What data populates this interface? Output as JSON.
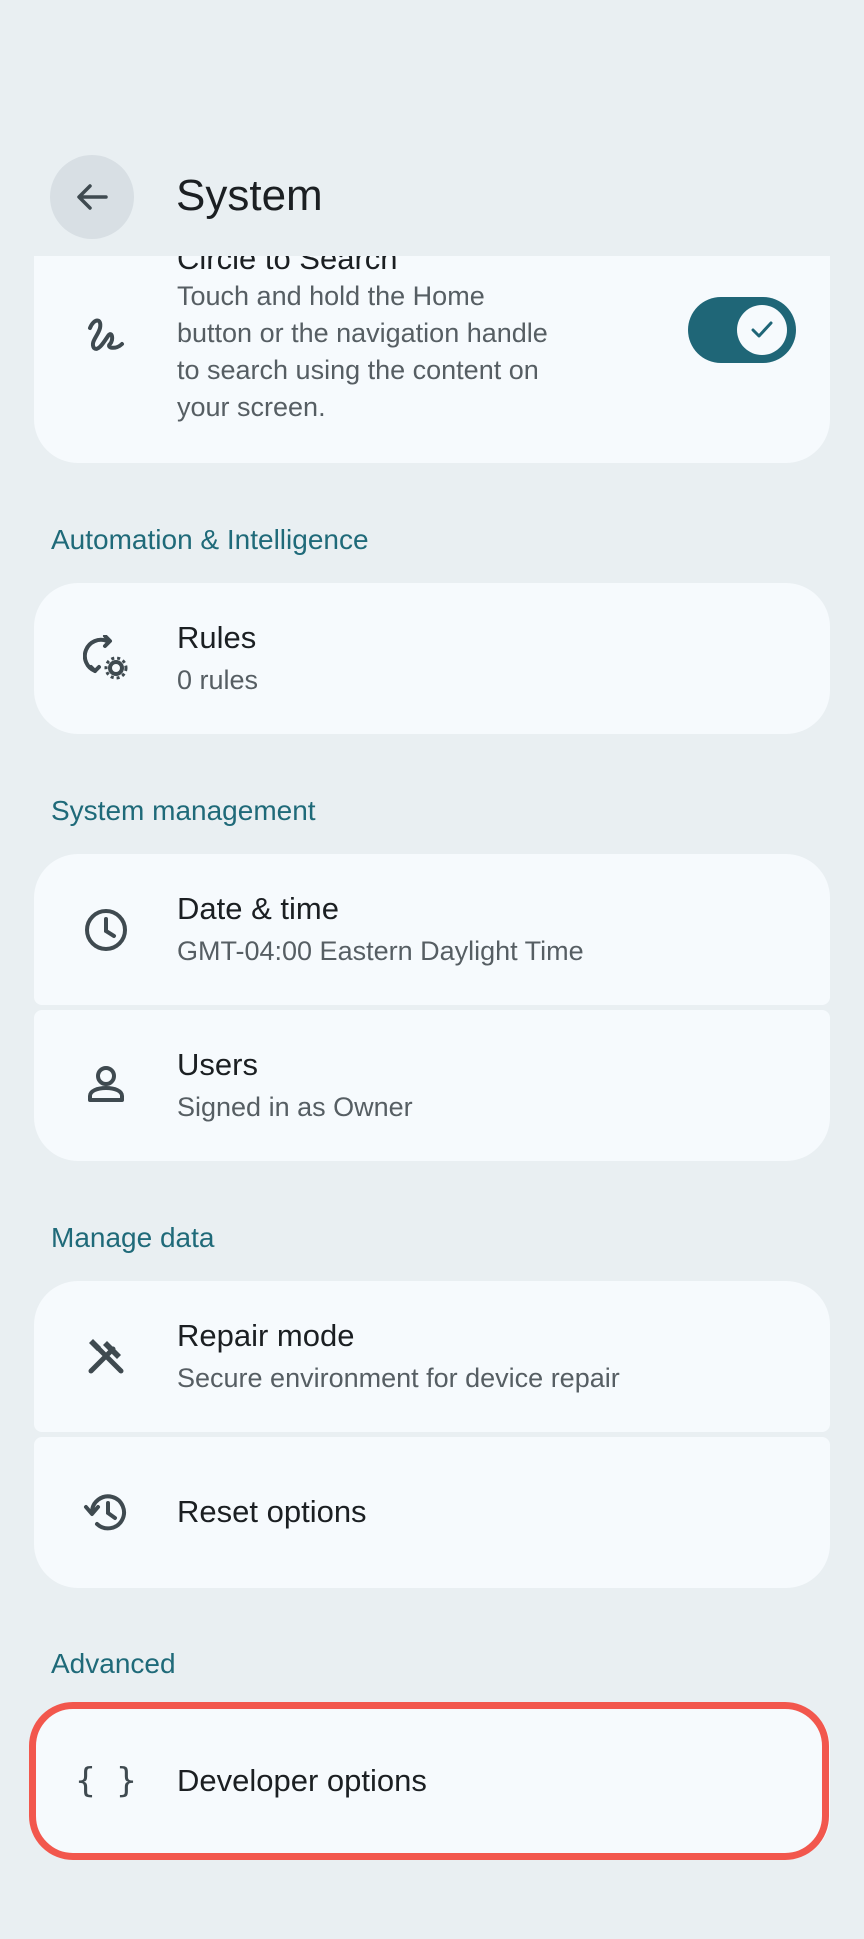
{
  "appbar": {
    "title": "System"
  },
  "circle_to_search": {
    "title": "Circle to Search",
    "description_lines": [
      "Touch and hold the Home",
      "button or the navigation handle",
      "to search using the content on",
      "your screen."
    ],
    "toggle_on": true
  },
  "sections": {
    "automation": {
      "header": "Automation & Intelligence",
      "rules": {
        "title": "Rules",
        "subtitle": "0 rules"
      }
    },
    "system_management": {
      "header": "System management",
      "date_time": {
        "title": "Date & time",
        "subtitle": "GMT-04:00 Eastern Daylight Time"
      },
      "users": {
        "title": "Users",
        "subtitle": "Signed in as Owner"
      }
    },
    "manage_data": {
      "header": "Manage data",
      "repair_mode": {
        "title": "Repair mode",
        "subtitle": "Secure environment for device repair"
      },
      "reset_options": {
        "title": "Reset options"
      }
    },
    "advanced": {
      "header": "Advanced",
      "developer_options": {
        "title": "Developer options",
        "icon_glyph": "{ }"
      }
    }
  },
  "colors": {
    "background": "#e9eff2",
    "card": "#f6fafd",
    "accent": "#1f6677",
    "section_header": "#1f6a79",
    "highlight": "#f2574d"
  }
}
